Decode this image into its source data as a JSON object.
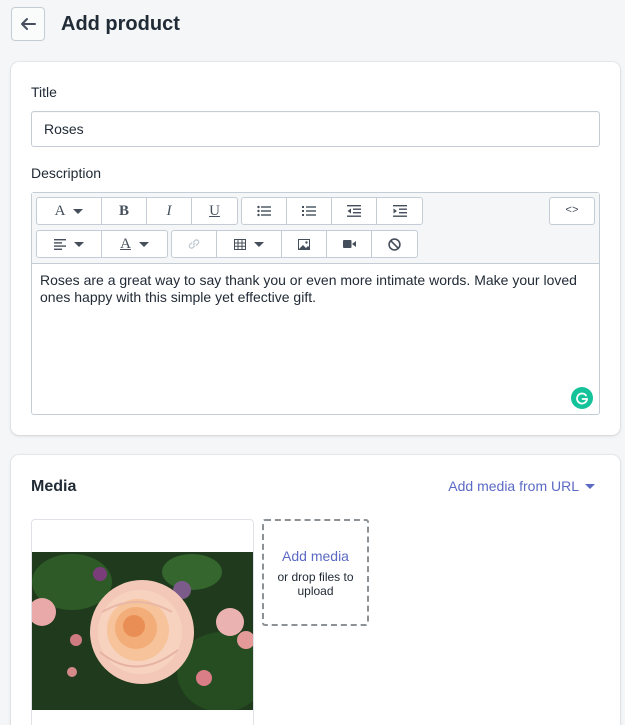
{
  "header": {
    "back_icon": "arrow-left-icon",
    "title": "Add product"
  },
  "details": {
    "title_label": "Title",
    "title_value": "Roses",
    "description_label": "Description",
    "description_text": "Roses are a great way to say thank you or even more intimate words. Make your loved ones happy with this simple yet effective gift.",
    "toolbar_row1": [
      "font-size-icon",
      "bold-icon",
      "italic-icon",
      "underline-icon",
      "bullet-list-icon",
      "numbered-list-icon",
      "outdent-icon",
      "indent-icon",
      "code-view-icon"
    ],
    "toolbar_row2": [
      "align-icon",
      "text-color-icon",
      "link-icon",
      "table-icon",
      "image-icon",
      "video-icon",
      "clear-format-icon"
    ],
    "toolbar_text": {
      "font": "A",
      "bold": "B",
      "italic": "I",
      "underline": "U",
      "text_color": "A",
      "code": "<>"
    },
    "grammarly_icon": "grammarly-icon"
  },
  "media": {
    "title": "Media",
    "add_from_url": "Add media from URL",
    "add_media": "Add media",
    "drop_hint": "or drop files to upload",
    "image_subject": "rose-photo"
  },
  "colors": {
    "accent": "#5c6ac4",
    "border": "#c4cdd5",
    "background": "#f4f6f8",
    "grammarly": "#15c39a"
  }
}
